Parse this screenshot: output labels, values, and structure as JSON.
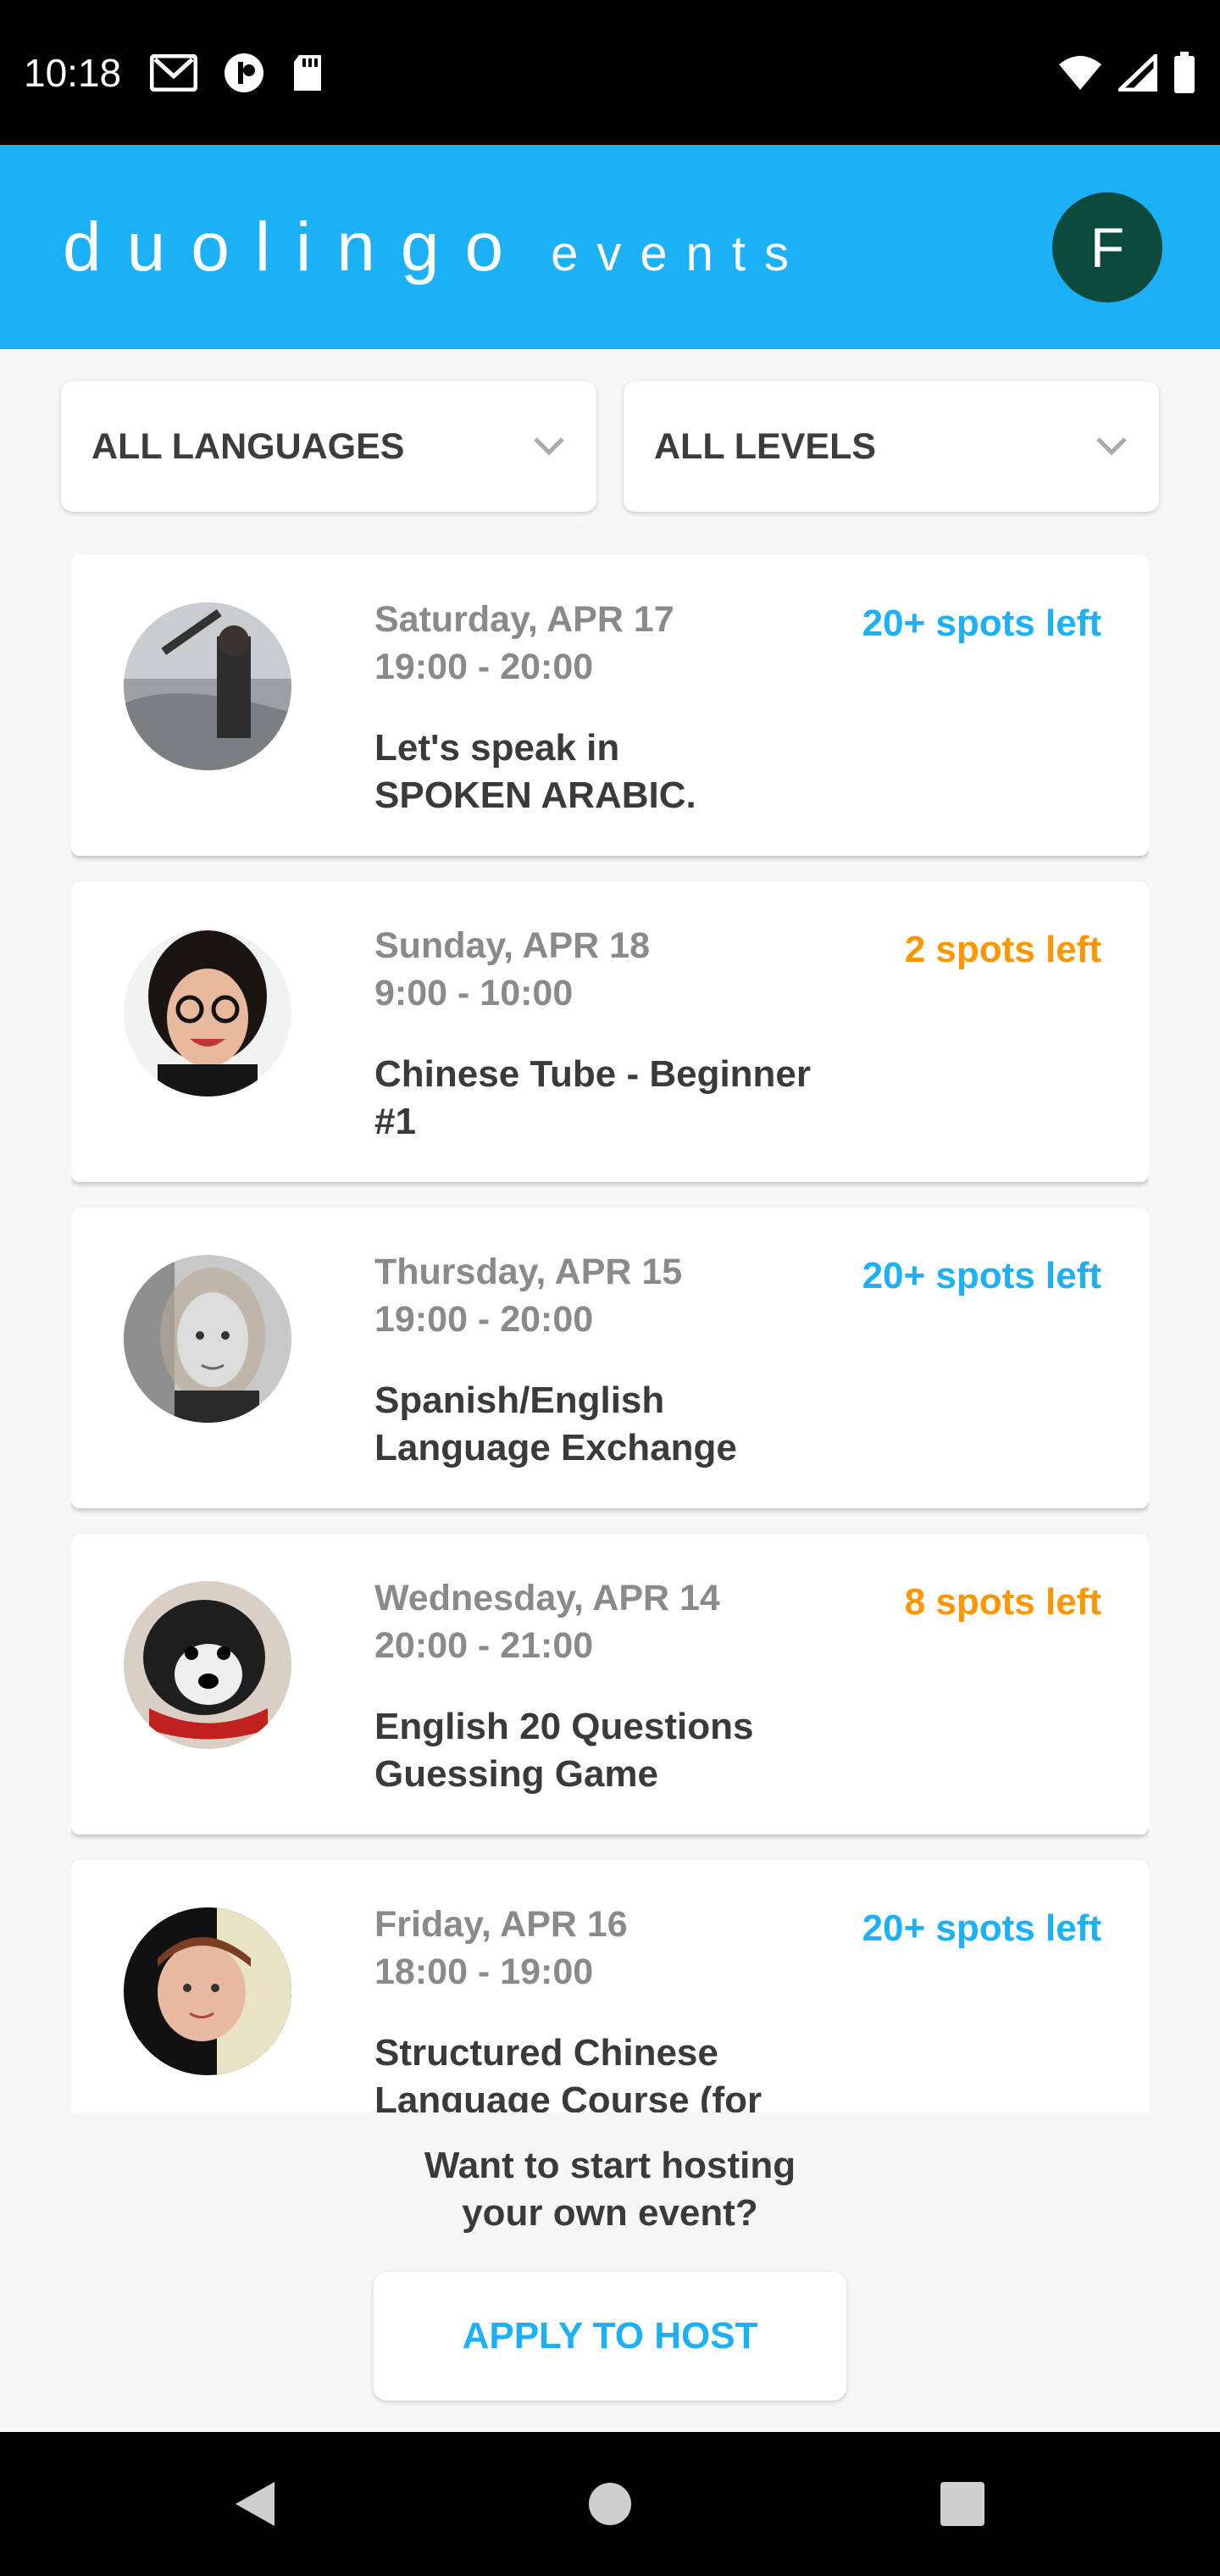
{
  "status_bar": {
    "time": "10:18"
  },
  "header": {
    "brand": "duolingo",
    "brand_sub": "events",
    "avatar_initial": "F"
  },
  "filters": {
    "language": "ALL LANGUAGES",
    "level": "ALL LEVELS"
  },
  "events": [
    {
      "date": "Saturday, APR 17",
      "time": "19:00 - 20:00",
      "title_line1": "Let's speak in",
      "title_line2": "SPOKEN ARABIC.",
      "spots": "20+ spots left",
      "spots_color": "#1cb0f6"
    },
    {
      "date": "Sunday, APR 18",
      "time": "9:00 - 10:00",
      "title_line1": "Chinese Tube - Beginner",
      "title_line2": "#1",
      "spots": "2 spots left",
      "spots_color": "#ff9600"
    },
    {
      "date": "Thursday, APR 15",
      "time": "19:00 - 20:00",
      "title_line1": "Spanish/English",
      "title_line2": "Language Exchange",
      "spots": "20+ spots left",
      "spots_color": "#1cb0f6"
    },
    {
      "date": "Wednesday, APR 14",
      "time": "20:00 - 21:00",
      "title_line1": "English 20 Questions",
      "title_line2": "Guessing Game",
      "spots": "8 spots left",
      "spots_color": "#ff9600"
    },
    {
      "date": "Friday, APR 16",
      "time": "18:00 - 19:00",
      "title_line1": "Structured Chinese",
      "title_line2": "Language Course (for",
      "spots": "20+ spots left",
      "spots_color": "#1cb0f6"
    }
  ],
  "host": {
    "prompt_line1": "Want to start hosting",
    "prompt_line2": "your own event?",
    "button": "APPLY TO HOST"
  },
  "colors": {
    "brand_blue": "#1cb0f6",
    "orange": "#ff9600",
    "avatar_green": "#0d4a3e"
  }
}
